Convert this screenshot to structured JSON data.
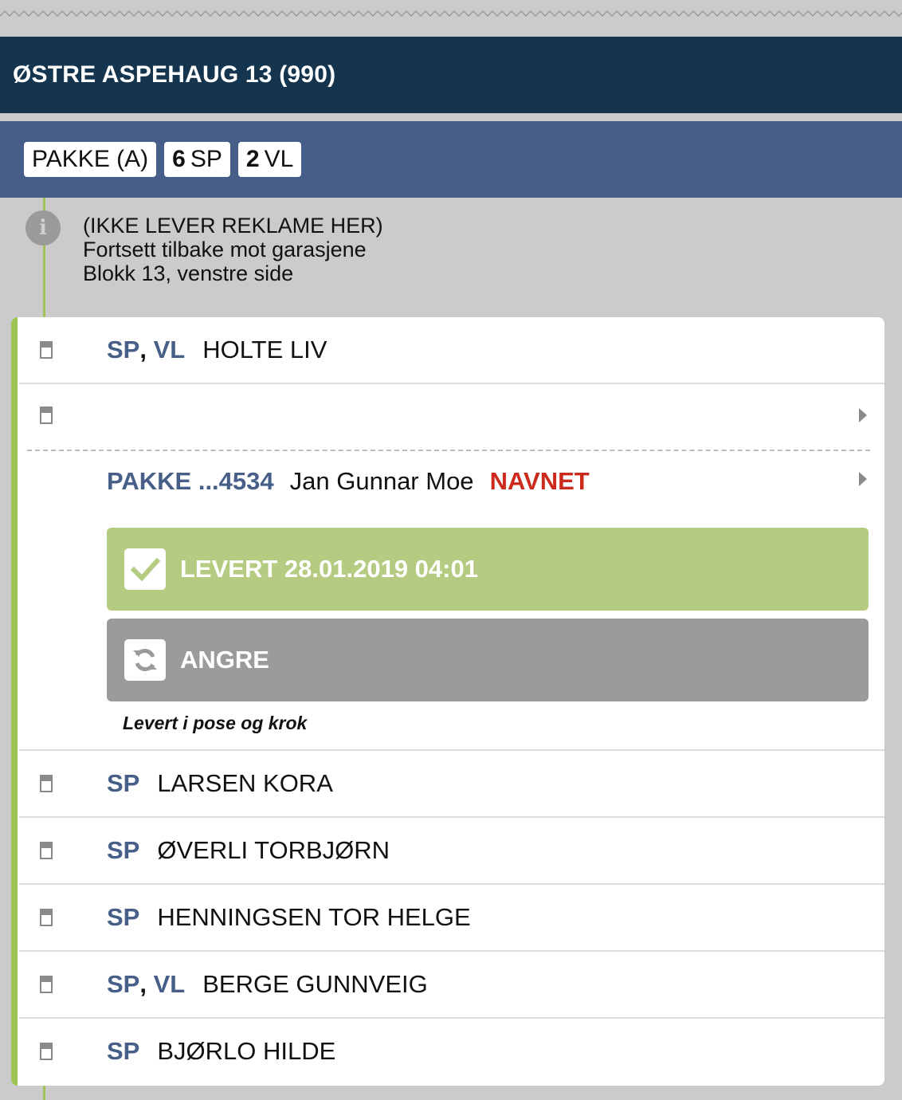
{
  "address": {
    "title": "ØSTRE ASPEHAUG 13 (990)"
  },
  "summary": {
    "chips": [
      {
        "count": "",
        "label": "PAKKE (A)"
      },
      {
        "count": "6",
        "label": "SP"
      },
      {
        "count": "2",
        "label": "VL"
      }
    ]
  },
  "info": {
    "lines": [
      "(IKKE LEVER REKLAME HER)",
      "Fortsett tilbake mot garasjene",
      "Blokk 13, venstre side"
    ]
  },
  "recipients": [
    {
      "tags": [
        "SP",
        "VL"
      ],
      "name": "HOLTE LIV"
    },
    {
      "tags": [],
      "name": ""
    },
    {
      "tags": [
        "SP"
      ],
      "name": "LARSEN KORA"
    },
    {
      "tags": [
        "SP"
      ],
      "name": "ØVERLI TORBJØRN"
    },
    {
      "tags": [
        "SP"
      ],
      "name": "HENNINGSEN TOR HELGE"
    },
    {
      "tags": [
        "SP",
        "VL"
      ],
      "name": "BERGE GUNNVEIG"
    },
    {
      "tags": [
        "SP"
      ],
      "name": "BJØRLO HILDE"
    }
  ],
  "package": {
    "id": "PAKKE ...4534",
    "recipient": "Jan Gunnar Moe",
    "status": "NAVNET",
    "delivered_label": "LEVERT 28.01.2019 04:01",
    "undo_label": "ANGRE",
    "note": "Levert i pose og krok"
  },
  "colors": {
    "header_bg": "#14354d",
    "summary_bg": "#475f88",
    "accent_green": "#9fc354",
    "delivered_bg": "#b5cb82",
    "undo_bg": "#9b9b9b",
    "status_red": "#cc2a1c"
  }
}
